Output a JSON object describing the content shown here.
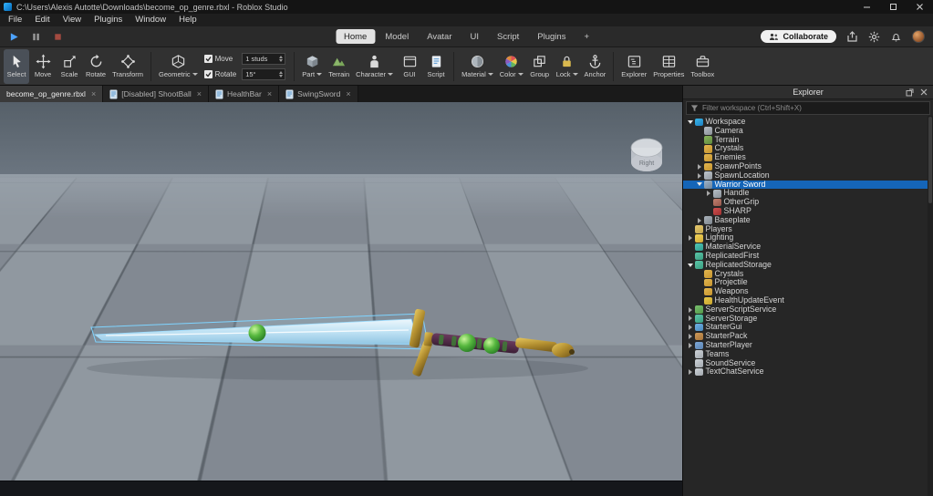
{
  "titlebar": {
    "title": "C:\\Users\\Alexis Autotte\\Downloads\\become_op_genre.rbxl - Roblox Studio"
  },
  "menubar": {
    "items": [
      "File",
      "Edit",
      "View",
      "Plugins",
      "Window",
      "Help"
    ]
  },
  "quickbar": {
    "playback_icons": [
      "play",
      "pause",
      "stop"
    ],
    "tabs": [
      "Home",
      "Model",
      "Avatar",
      "UI",
      "Script",
      "Plugins",
      "+"
    ],
    "active_tab": "Home",
    "collaborate_label": "Collaborate",
    "right_icons": [
      "share",
      "settings",
      "notifications",
      "avatar"
    ]
  },
  "ribbon": {
    "tools": [
      {
        "label": "Select",
        "icon": "select",
        "active": true
      },
      {
        "label": "Move",
        "icon": "move"
      },
      {
        "label": "Scale",
        "icon": "scale"
      },
      {
        "label": "Rotate",
        "icon": "rotate"
      },
      {
        "label": "Transform",
        "icon": "transform"
      }
    ],
    "mode": {
      "label": "Geometric",
      "icon": "geometric",
      "dropdown": true
    },
    "snap": {
      "move": {
        "label": "Move",
        "checked": true,
        "value": "1 studs"
      },
      "rotate": {
        "label": "Rotate",
        "checked": true,
        "value": "15°"
      }
    },
    "insert": [
      {
        "label": "Part",
        "icon": "part",
        "dropdown": true
      },
      {
        "label": "Terrain",
        "icon": "terrain"
      },
      {
        "label": "Character",
        "icon": "character",
        "dropdown": true
      },
      {
        "label": "GUI",
        "icon": "gui"
      },
      {
        "label": "Script",
        "icon": "script"
      }
    ],
    "edit": [
      {
        "label": "Material",
        "icon": "material",
        "dropdown": true
      },
      {
        "label": "Color",
        "icon": "color",
        "dropdown": true
      },
      {
        "label": "Group",
        "icon": "group"
      },
      {
        "label": "Lock",
        "icon": "lock",
        "dropdown": true
      },
      {
        "label": "Anchor",
        "icon": "anchor"
      }
    ],
    "windows": [
      {
        "label": "Explorer",
        "icon": "explorer-window"
      },
      {
        "label": "Properties",
        "icon": "properties-window"
      },
      {
        "label": "Toolbox",
        "icon": "toolbox"
      }
    ]
  },
  "doc_tabs": [
    {
      "label": "become_op_genre.rbxl",
      "icon": null,
      "active": true
    },
    {
      "label": "[Disabled] ShootBall",
      "icon": "script",
      "active": false
    },
    {
      "label": "HealthBar",
      "icon": "script",
      "active": false
    },
    {
      "label": "SwingSword",
      "icon": "script",
      "active": false
    }
  ],
  "viewport": {
    "view_indicator": "Right",
    "selection_color": "#7fd4ff"
  },
  "explorer": {
    "title": "Explorer",
    "header_icons": [
      "popout",
      "close"
    ],
    "filter_placeholder": "Filter workspace (Ctrl+Shift+X)",
    "selection_color": "#1565b8",
    "tree": [
      {
        "label": "Workspace",
        "level": 0,
        "arrow": "open",
        "icon": "workspace"
      },
      {
        "label": "Camera",
        "level": 1,
        "arrow": null,
        "icon": "camera"
      },
      {
        "label": "Terrain",
        "level": 1,
        "arrow": null,
        "icon": "terrain"
      },
      {
        "label": "Crystals",
        "level": 1,
        "arrow": null,
        "icon": "folder"
      },
      {
        "label": "Enemies",
        "level": 1,
        "arrow": null,
        "icon": "folder"
      },
      {
        "label": "SpawnPoints",
        "level": 1,
        "arrow": "closed",
        "icon": "folder"
      },
      {
        "label": "SpawnLocation",
        "level": 1,
        "arrow": "closed",
        "icon": "spawn"
      },
      {
        "label": "Warrior Sword",
        "level": 1,
        "arrow": "open",
        "icon": "tool",
        "selected": true
      },
      {
        "label": "Handle",
        "level": 2,
        "arrow": "closed",
        "icon": "handle"
      },
      {
        "label": "OtherGrip",
        "level": 2,
        "arrow": null,
        "icon": "grip"
      },
      {
        "label": "SHARP",
        "level": 2,
        "arrow": null,
        "icon": "sharp"
      },
      {
        "label": "Baseplate",
        "level": 1,
        "arrow": "closed",
        "icon": "baseplate"
      },
      {
        "label": "Players",
        "level": 0,
        "arrow": null,
        "icon": "players"
      },
      {
        "label": "Lighting",
        "level": 0,
        "arrow": "closed",
        "icon": "lighting"
      },
      {
        "label": "MaterialService",
        "level": 0,
        "arrow": null,
        "icon": "material-service"
      },
      {
        "label": "ReplicatedFirst",
        "level": 0,
        "arrow": null,
        "icon": "replicated-first"
      },
      {
        "label": "ReplicatedStorage",
        "level": 0,
        "arrow": "open",
        "icon": "replicated-storage"
      },
      {
        "label": "Crystals",
        "level": 1,
        "arrow": null,
        "icon": "folder"
      },
      {
        "label": "Projectile",
        "level": 1,
        "arrow": null,
        "icon": "folder"
      },
      {
        "label": "Weapons",
        "level": 1,
        "arrow": null,
        "icon": "folder"
      },
      {
        "label": "HealthUpdateEvent",
        "level": 1,
        "arrow": null,
        "icon": "remote-event"
      },
      {
        "label": "ServerScriptService",
        "level": 0,
        "arrow": "closed",
        "icon": "server-script-service"
      },
      {
        "label": "ServerStorage",
        "level": 0,
        "arrow": "closed",
        "icon": "server-storage"
      },
      {
        "label": "StarterGui",
        "level": 0,
        "arrow": "closed",
        "icon": "starter-gui"
      },
      {
        "label": "StarterPack",
        "level": 0,
        "arrow": "closed",
        "icon": "starter-pack"
      },
      {
        "label": "StarterPlayer",
        "level": 0,
        "arrow": "closed",
        "icon": "starter-player"
      },
      {
        "label": "Teams",
        "level": 0,
        "arrow": null,
        "icon": "teams"
      },
      {
        "label": "SoundService",
        "level": 0,
        "arrow": null,
        "icon": "sound-service"
      },
      {
        "label": "TextChatService",
        "level": 0,
        "arrow": "closed",
        "icon": "text-chat-service"
      }
    ]
  }
}
